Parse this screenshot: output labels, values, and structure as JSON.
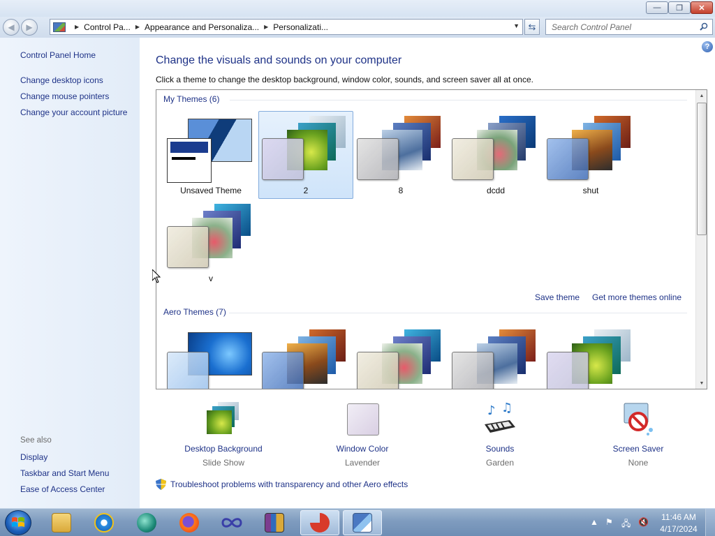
{
  "window": {
    "minimize_label": "—",
    "maximize_label": "❐",
    "close_label": "✕"
  },
  "address": {
    "crumbs": [
      "Control Pa...",
      "Appearance and Personaliza...",
      "Personalizati..."
    ],
    "search_placeholder": "Search Control Panel"
  },
  "sidebar": {
    "home": "Control Panel Home",
    "links": [
      "Change desktop icons",
      "Change mouse pointers",
      "Change your account picture"
    ],
    "see_also_title": "See also",
    "see_also": [
      "Display",
      "Taskbar and Start Menu",
      "Ease of Access Center"
    ]
  },
  "main": {
    "heading": "Change the visuals and sounds on your computer",
    "subtitle": "Click a theme to change the desktop background, window color, sounds, and screen saver all at once.",
    "my_themes_header": "My Themes (6)",
    "my_themes": [
      {
        "name": "Unsaved Theme",
        "selected": false
      },
      {
        "name": "2",
        "selected": true
      },
      {
        "name": "8",
        "selected": false
      },
      {
        "name": "dcdd",
        "selected": false
      },
      {
        "name": "shut",
        "selected": false
      },
      {
        "name": "v",
        "selected": false
      }
    ],
    "save_theme": "Save theme",
    "get_more": "Get more themes online",
    "aero_header": "Aero Themes (7)",
    "settings": [
      {
        "label": "Desktop Background",
        "value": "Slide Show"
      },
      {
        "label": "Window Color",
        "value": "Lavender"
      },
      {
        "label": "Sounds",
        "value": "Garden"
      },
      {
        "label": "Screen Saver",
        "value": "None"
      }
    ],
    "troubleshoot": "Troubleshoot problems with transparency and other Aero effects"
  },
  "taskbar": {
    "time": "11:46 AM",
    "date": "4/17/2024"
  }
}
